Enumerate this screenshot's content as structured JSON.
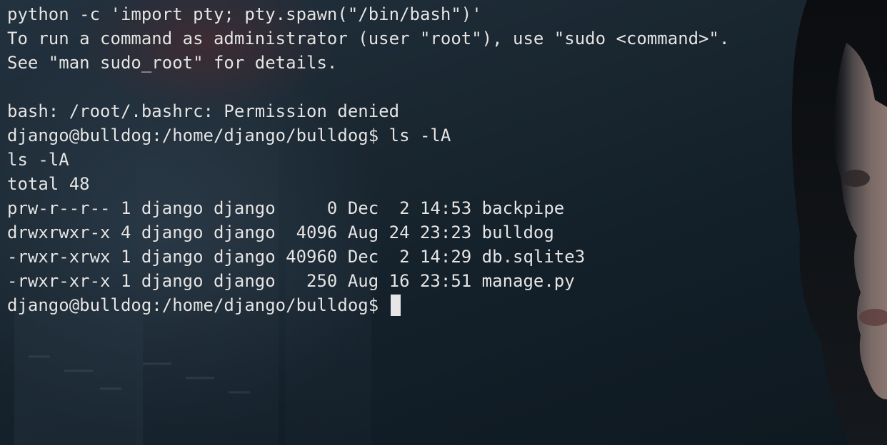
{
  "terminal": {
    "lines": [
      "python -c 'import pty; pty.spawn(\"/bin/bash\")'",
      "To run a command as administrator (user \"root\"), use \"sudo <command>\".",
      "See \"man sudo_root\" for details.",
      "",
      "bash: /root/.bashrc: Permission denied",
      "django@bulldog:/home/django/bulldog$ ls -lA",
      "ls -lA",
      "total 48",
      "prw-r--r-- 1 django django     0 Dec  2 14:53 backpipe",
      "drwxrwxr-x 4 django django  4096 Aug 24 23:23 bulldog",
      "-rwxr-xrwx 1 django django 40960 Dec  2 14:29 db.sqlite3",
      "-rwxr-xr-x 1 django django   250 Aug 16 23:51 manage.py"
    ],
    "prompt": "django@bulldog:/home/django/bulldog$ "
  },
  "colors": {
    "text": "#e6e6e6",
    "background": "#101a22"
  }
}
